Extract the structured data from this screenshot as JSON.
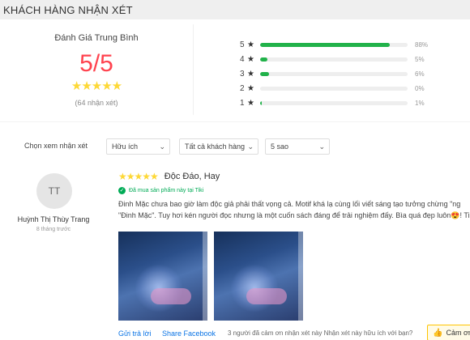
{
  "header": {
    "title": "KHÁCH HÀNG NHẬN XÉT"
  },
  "summary": {
    "title": "Đánh Giá Trung Bình",
    "score": "5/5",
    "stars": "★★★★★",
    "count": "(64 nhận xét)"
  },
  "distribution": [
    {
      "stars": "5",
      "percent_label": "88%",
      "fraction": 0.88
    },
    {
      "stars": "4",
      "percent_label": "5%",
      "fraction": 0.05
    },
    {
      "stars": "3",
      "percent_label": "6%",
      "fraction": 0.06
    },
    {
      "stars": "2",
      "percent_label": "0%",
      "fraction": 0.0
    },
    {
      "stars": "1",
      "percent_label": "1%",
      "fraction": 0.01
    }
  ],
  "filters": {
    "label": "Chọn xem nhận xét",
    "sort": "Hữu ích",
    "audience": "Tất cả khách hàng",
    "rating": "5 sao"
  },
  "reviewer": {
    "initials": "TT",
    "name": "Huỳnh Thị Thùy Trang",
    "time": "8 tháng trước"
  },
  "review": {
    "stars": "★★★★★",
    "title": "Độc Đáo, Hay",
    "bought": "Đã mua sản phẩm này tại Tiki",
    "line1": "Đinh Mặc chưa bao giờ làm độc giả phải thất vọng cả. Motif khá lạ cùng lối viết sáng tạo tưởng chừng \"ng",
    "line2": "\"Đinh Mặc\". Tuy hơi kén người đọc nhưng là một cuốn sách đáng để trải nghiệm đấy. Bìa quá đẹp luôn😍! Ti"
  },
  "actions": {
    "reply": "Gửi trả lời",
    "share": "Share Facebook",
    "thanks_text": "3 người đã cảm ơn nhận xét này Nhận xét này hữu ích với bạn?",
    "thank_button": "Cảm ơn"
  },
  "colors": {
    "score": "#ff424e",
    "stars": "#fdd836",
    "bar_fill": "#21b24a",
    "link": "#0b74e5",
    "bought": "#00ab56"
  }
}
